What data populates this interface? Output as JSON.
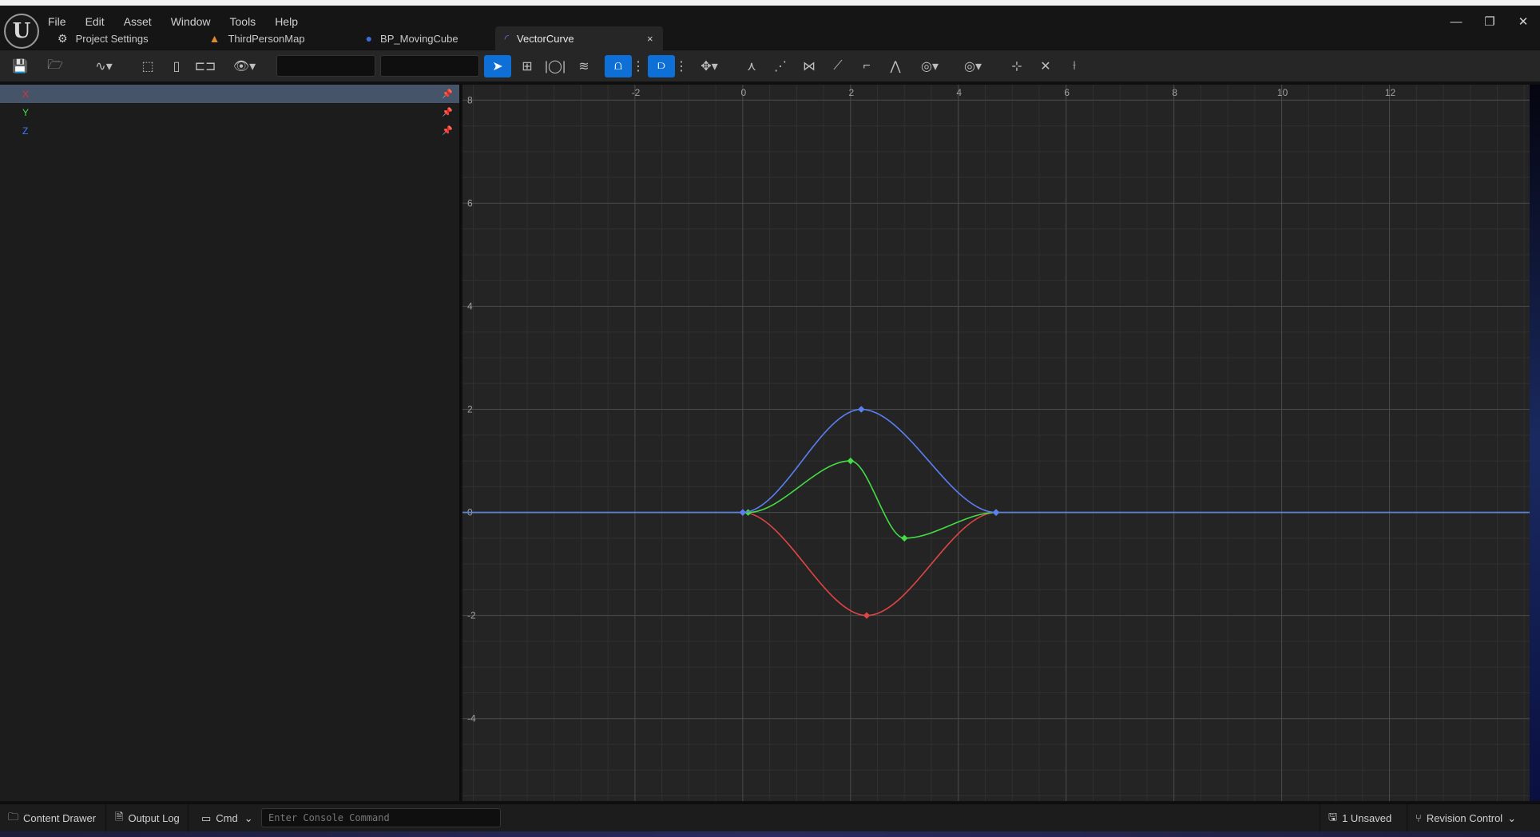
{
  "menu": [
    "File",
    "Edit",
    "Asset",
    "Window",
    "Tools",
    "Help"
  ],
  "tabs": [
    {
      "label": "Project Settings",
      "icon": "gear-icon"
    },
    {
      "label": "ThirdPersonMap",
      "icon": "map-icon"
    },
    {
      "label": "BP_MovingCube",
      "icon": "blueprint-icon"
    },
    {
      "label": "VectorCurve",
      "icon": "curve-icon",
      "active": true,
      "close": "×"
    }
  ],
  "window_controls": {
    "minimize": "—",
    "restore": "❐",
    "close": "✕"
  },
  "channels": [
    {
      "label": "X",
      "color": "#e03030",
      "selected": true
    },
    {
      "label": "Y",
      "color": "#3ee23e"
    },
    {
      "label": "Z",
      "color": "#3a78ff"
    }
  ],
  "colors": {
    "accent": "#0e70d6",
    "x_curve": "#e04545",
    "y_curve": "#45dd45",
    "z_curve": "#5a7ff0"
  },
  "chart_data": {
    "type": "line",
    "x_ticks": [
      "-2",
      "0",
      "2",
      "4",
      "6",
      "8",
      "10",
      "12"
    ],
    "y_ticks": [
      "8",
      "6",
      "4",
      "2",
      "0",
      "-2",
      "-4"
    ],
    "xlim": [
      -5.2,
      14.6
    ],
    "ylim": [
      -5.6,
      8.3
    ],
    "grid": true,
    "series": [
      {
        "name": "X",
        "color": "#e04545",
        "keys": [
          [
            0,
            0
          ],
          [
            2.3,
            -2
          ],
          [
            4.7,
            0
          ]
        ]
      },
      {
        "name": "Y",
        "color": "#45dd45",
        "keys": [
          [
            0.1,
            0
          ],
          [
            2,
            1
          ],
          [
            3,
            -0.5
          ],
          [
            4.7,
            0
          ]
        ]
      },
      {
        "name": "Z",
        "color": "#5a7ff0",
        "keys": [
          [
            0,
            0
          ],
          [
            2.2,
            2
          ],
          [
            4.7,
            0
          ]
        ]
      }
    ]
  },
  "status": {
    "content_drawer": "Content Drawer",
    "output_log": "Output Log",
    "cmd": "Cmd",
    "console_placeholder": "Enter Console Command",
    "unsaved": "1 Unsaved",
    "revision_control": "Revision Control"
  }
}
